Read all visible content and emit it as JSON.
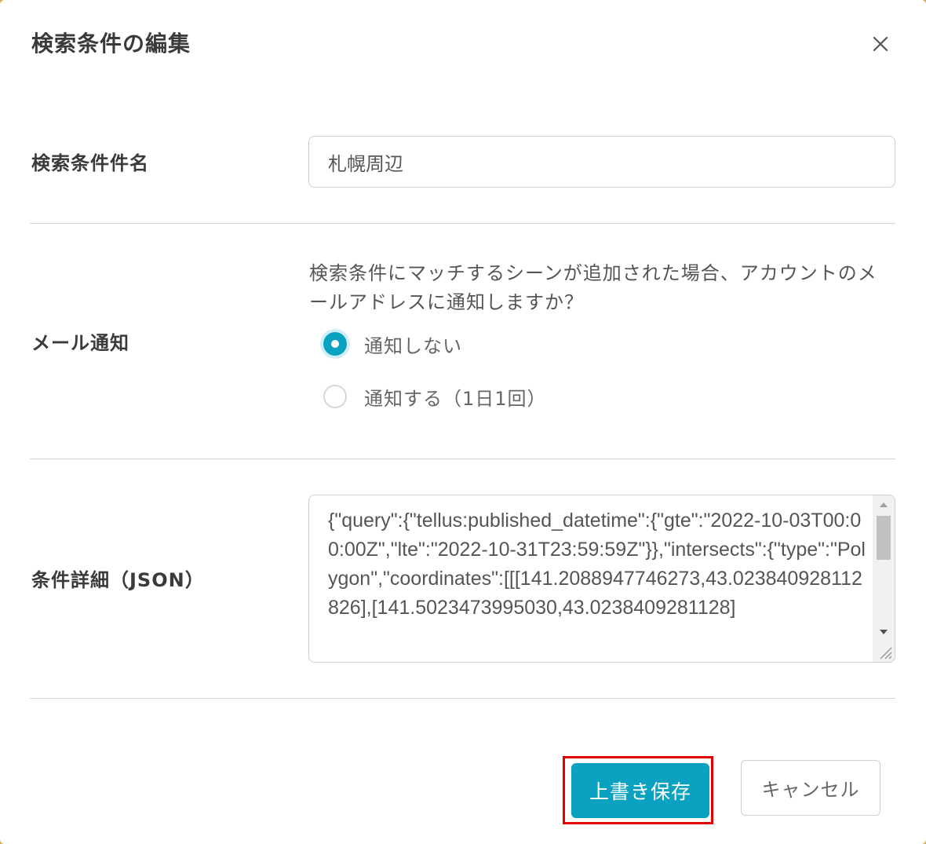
{
  "dialog": {
    "title": "検索条件の編集"
  },
  "name_field": {
    "label": "検索条件件名",
    "value": "札幌周辺"
  },
  "email_notify": {
    "label": "メール通知",
    "description": "検索条件にマッチするシーンが追加された場合、アカウントのメールアドレスに通知しますか？",
    "options": [
      {
        "label": "通知しない",
        "checked": true
      },
      {
        "label": "通知する（1日1回）",
        "checked": false
      }
    ]
  },
  "json_detail": {
    "label": "条件詳細（JSON）",
    "value": "{\"query\":{\"tellus:published_datetime\":{\"gte\":\"2022-10-03T00:00:00Z\",\"lte\":\"2022-10-31T23:59:59Z\"}},\"intersects\":{\"type\":\"Polygon\",\"coordinates\":[[[141.2088947746273,43.023840928112826],[141.5023473995030,43.0238409281128]"
  },
  "footer": {
    "save_label": "上書き保存",
    "cancel_label": "キャンセル"
  },
  "colors": {
    "accent": "#0aa2c0",
    "highlight_border": "#e00000"
  },
  "icons": {
    "close": "close-icon"
  }
}
